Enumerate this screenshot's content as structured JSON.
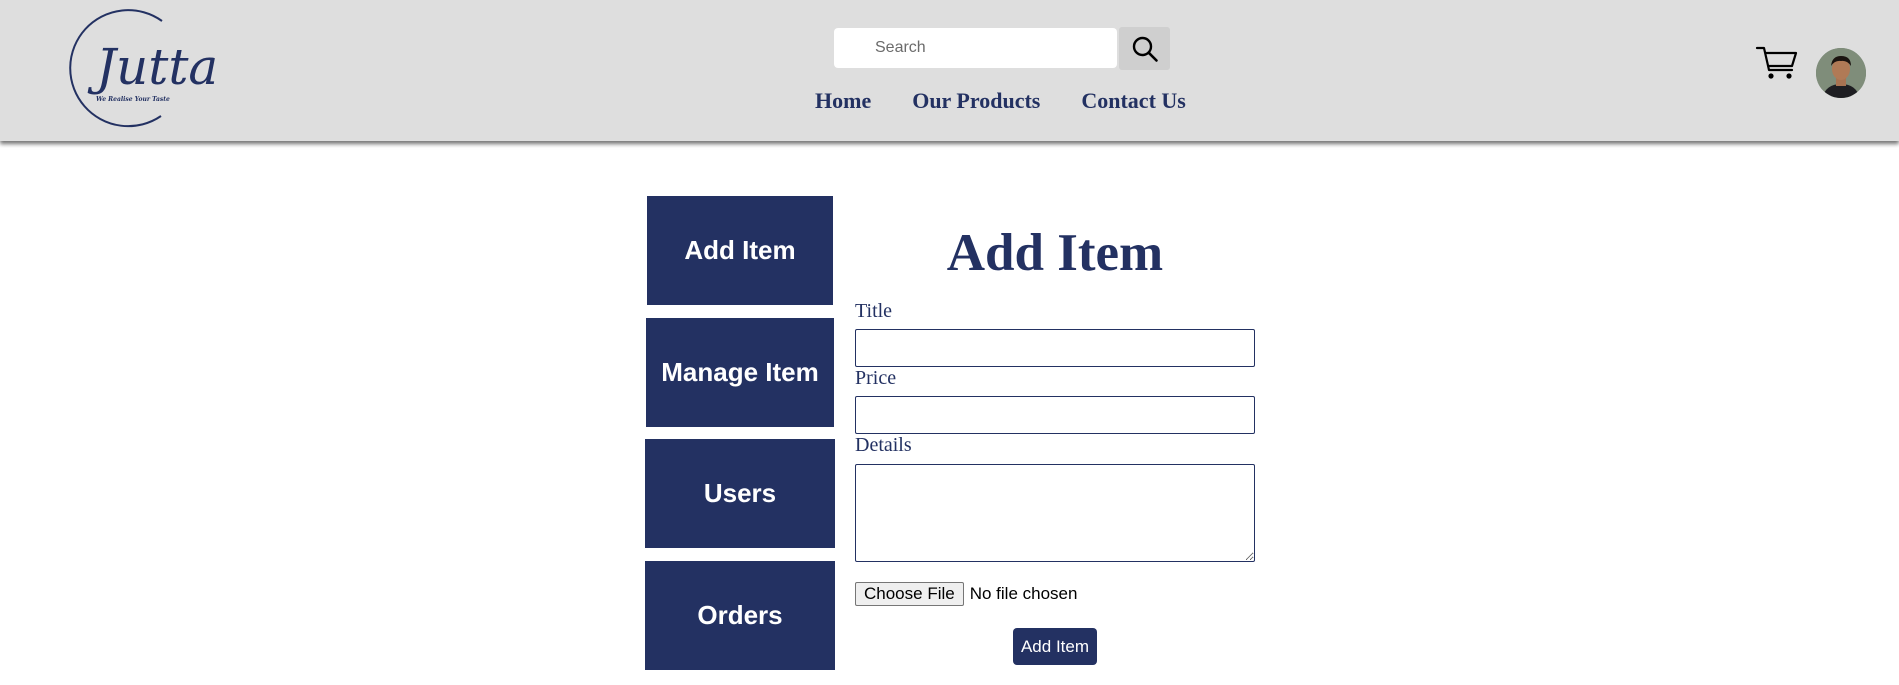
{
  "header": {
    "logo": {
      "wordmark": "Jutta",
      "tagline": "We Realise Your Taste"
    },
    "search": {
      "placeholder": "Search",
      "value": "",
      "button_icon": "search-icon"
    },
    "nav": [
      {
        "label": "Home"
      },
      {
        "label": "Our Products"
      },
      {
        "label": "Contact Us"
      }
    ],
    "cart_icon": "cart-icon",
    "avatar_icon": "user-avatar"
  },
  "sidebar": {
    "items": [
      {
        "label": "Add Item"
      },
      {
        "label": "Manage Item"
      },
      {
        "label": "Users"
      },
      {
        "label": "Orders"
      }
    ]
  },
  "form": {
    "title": "Add Item",
    "fields": {
      "title_label": "Title",
      "title_value": "",
      "price_label": "Price",
      "price_value": "",
      "details_label": "Details",
      "details_value": ""
    },
    "file": {
      "button_label": "Choose File",
      "status": "No file chosen"
    },
    "submit_label": "Add Item"
  },
  "colors": {
    "primary": "#233162",
    "header_bg": "#dedede",
    "page_bg": "#ffffff"
  }
}
